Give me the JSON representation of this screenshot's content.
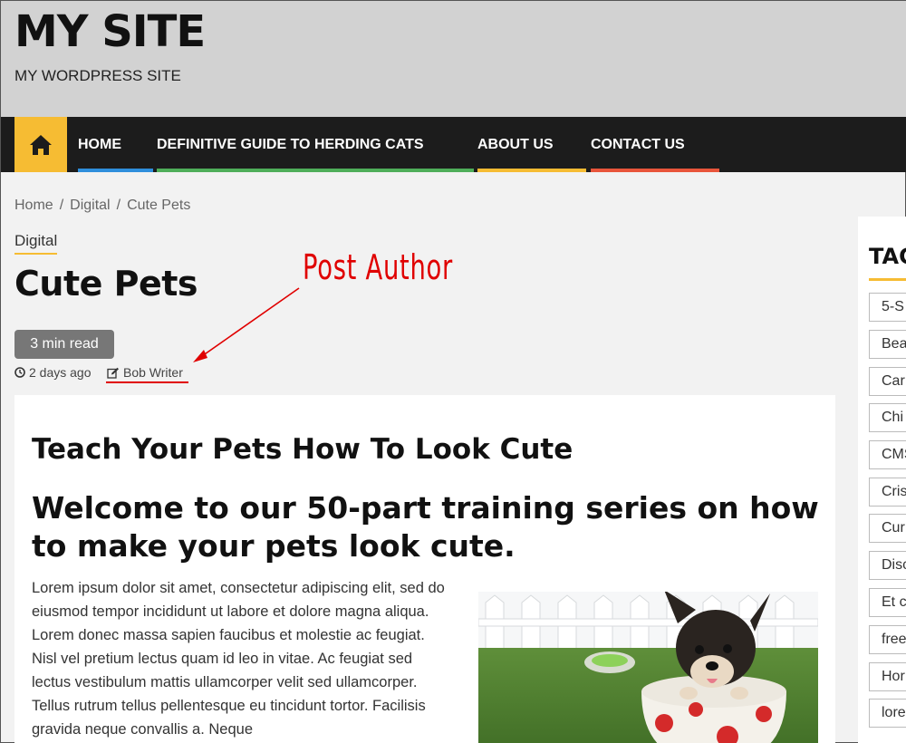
{
  "site": {
    "title": "MY SITE",
    "tagline": "MY WORDPRESS SITE"
  },
  "nav": {
    "home_icon": "home-icon",
    "items": [
      {
        "label": "HOME",
        "color": "#2f8fdc"
      },
      {
        "label": "DEFINITIVE GUIDE TO HERDING CATS",
        "color": "#4fae5a"
      },
      {
        "label": "ABOUT US",
        "color": "#f6bc33"
      },
      {
        "label": "CONTACT US",
        "color": "#e8553b"
      }
    ]
  },
  "breadcrumb": {
    "items": [
      "Home",
      "Digital",
      "Cute Pets"
    ],
    "separator": "/"
  },
  "post": {
    "category": "Digital",
    "title": "Cute Pets",
    "read_time": "3 min read",
    "date": "2 days ago",
    "author": "Bob Writer"
  },
  "annotation": {
    "label": "Post Author",
    "color": "#e00000"
  },
  "article": {
    "heading": "Teach Your Pets How To Look Cute",
    "subheading": "Welcome to our 50-part training series on how to make your pets look cute.",
    "body": "Lorem ipsum dolor sit amet, consectetur adipiscing elit, sed do eiusmod tempor incididunt ut labore et dolore magna aliqua. Lorem donec massa sapien faucibus et molestie ac feugiat. Nisl vel pretium lectus quam id leo in vitae. Ac feugiat sed lectus vestibulum mattis ullamcorper velit sed ullamcorper. Tellus rutrum tellus pellentesque eu tincidunt tortor. Facilisis gravida neque convallis a. Neque"
  },
  "sidebar": {
    "title": "TAGS",
    "tags": [
      "5-S",
      "Bea",
      "Car",
      "Chi",
      "CMS",
      "Cris",
      "Cur",
      "Disc",
      "Et c",
      "free",
      "Hor",
      "lore"
    ]
  },
  "colors": {
    "accent": "#f6bc33",
    "nav_bg": "#1c1c1c",
    "header_bg": "#d2d2d2"
  }
}
